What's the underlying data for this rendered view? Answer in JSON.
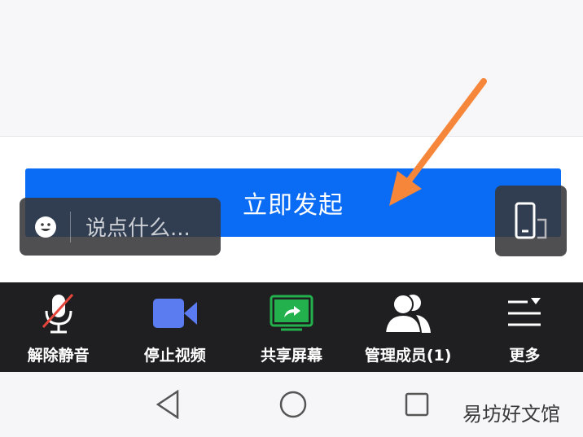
{
  "start_button": {
    "label": "立即发起"
  },
  "chat": {
    "placeholder": "说点什么..."
  },
  "toolbar": {
    "items": [
      {
        "label": "解除静音",
        "icon": "microphone-muted-icon"
      },
      {
        "label": "停止视频",
        "icon": "video-camera-icon"
      },
      {
        "label": "共享屏幕",
        "icon": "share-screen-icon"
      },
      {
        "label": "管理成员(1)",
        "icon": "members-icon"
      },
      {
        "label": "更多",
        "icon": "more-menu-icon"
      }
    ]
  },
  "navbar": {
    "buttons": [
      "back-icon",
      "home-icon",
      "recents-icon"
    ]
  },
  "watermark": "易坊好文馆",
  "colors": {
    "accent": "#0a6cf5",
    "toolbar_bg": "#1f1f21",
    "arrow": "#f5863a",
    "share_green": "#23b14d",
    "video_blue": "#5b7cf0",
    "mute_red": "#e8453c"
  }
}
